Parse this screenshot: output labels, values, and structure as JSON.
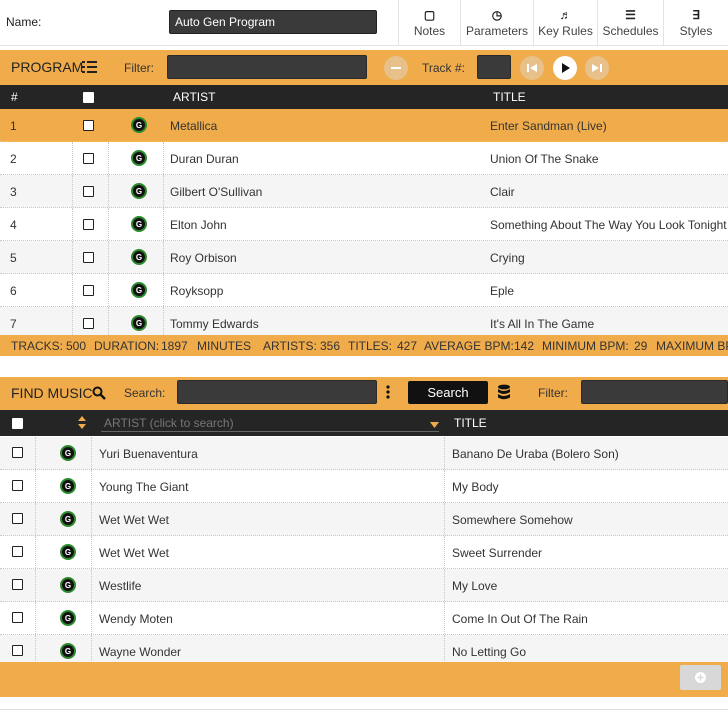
{
  "header": {
    "name_label": "Name:",
    "name_value": "Auto Gen Program",
    "toolbar": [
      {
        "label": "Notes",
        "icon": "▢"
      },
      {
        "label": "Parameters",
        "icon": "◷"
      },
      {
        "label": "Key Rules",
        "icon": "♬"
      },
      {
        "label": "Schedules",
        "icon": "☰"
      },
      {
        "label": "Styles",
        "icon": "∃"
      }
    ]
  },
  "program": {
    "title": "PROGRAM",
    "filter_label": "Filter:",
    "track_label": "Track #:",
    "columns": {
      "num": "#",
      "artist": "ARTIST",
      "title": "TITLE"
    },
    "rows": [
      {
        "num": "1",
        "badge": "G",
        "artist": "Metallica",
        "title": "Enter Sandman (Live)"
      },
      {
        "num": "2",
        "badge": "G",
        "artist": "Duran Duran",
        "title": "Union Of The Snake"
      },
      {
        "num": "3",
        "badge": "G",
        "artist": "Gilbert O'Sullivan",
        "title": "Clair"
      },
      {
        "num": "4",
        "badge": "G",
        "artist": "Elton John",
        "title": "Something About The Way You Look Tonight"
      },
      {
        "num": "5",
        "badge": "G",
        "artist": "Roy Orbison",
        "title": "Crying"
      },
      {
        "num": "6",
        "badge": "G",
        "artist": "Royksopp",
        "title": "Eple"
      },
      {
        "num": "7",
        "badge": "G",
        "artist": "Tommy Edwards",
        "title": "It's All In The Game"
      }
    ],
    "stats": {
      "tracks_label": "TRACKS:",
      "tracks": "500",
      "duration_label": "DURATION:",
      "duration": "1897",
      "minutes_label": "MINUTES",
      "artists_label": "ARTISTS:",
      "artists": "356",
      "titles_label": "TITLES:",
      "titles": "427",
      "avg_bpm_label": "AVERAGE BPM:",
      "avg_bpm": "142",
      "min_bpm_label": "MINIMUM BPM:",
      "min_bpm": "29",
      "max_bpm_label": "MAXIMUM BP"
    }
  },
  "find": {
    "title": "FIND MUSIC",
    "search_label": "Search:",
    "search_button": "Search",
    "filter_label": "Filter:",
    "columns": {
      "artist": "ARTIST (click to search)",
      "title": "TITLE"
    },
    "rows": [
      {
        "badge": "G",
        "artist": "Yuri Buenaventura",
        "title": "Banano De Uraba (Bolero Son)"
      },
      {
        "badge": "G",
        "artist": "Young The Giant",
        "title": "My Body"
      },
      {
        "badge": "G",
        "artist": "Wet Wet Wet",
        "title": "Somewhere Somehow"
      },
      {
        "badge": "G",
        "artist": "Wet Wet Wet",
        "title": "Sweet Surrender"
      },
      {
        "badge": "G",
        "artist": "Westlife",
        "title": "My Love"
      },
      {
        "badge": "G",
        "artist": "Wendy Moten",
        "title": "Come In Out Of The Rain"
      },
      {
        "badge": "G",
        "artist": "Wayne Wonder",
        "title": "No Letting Go"
      }
    ]
  },
  "colors": {
    "accent": "#f0ac4b",
    "dark": "#252525",
    "badge_ring": "#2c8a2c"
  }
}
